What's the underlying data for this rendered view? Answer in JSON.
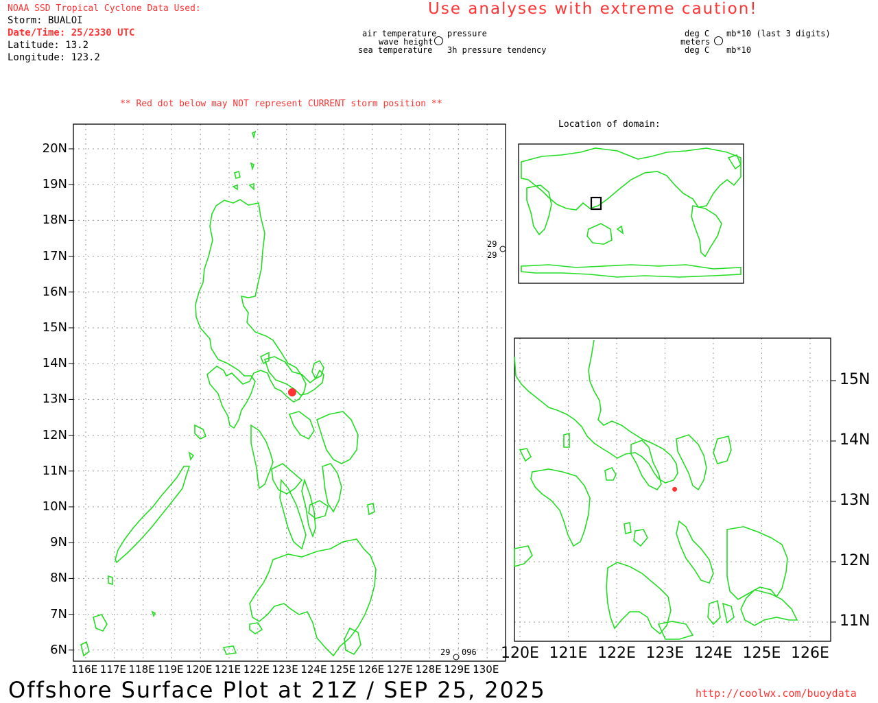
{
  "header": {
    "source_label": "NOAA SSD Tropical Cyclone Data Used:",
    "storm_line": "Storm: BUALOI",
    "datetime_line": "Date/Time: 25/2330 UTC",
    "latitude_line": "Latitude: 13.2",
    "longitude_line": "Longitude: 123.2",
    "caution": "Use analyses with extreme caution!",
    "red_dot_note": "** Red dot below may NOT represent CURRENT storm position **"
  },
  "legend": {
    "air_temperature": "air temperature",
    "wave_height": "wave height",
    "sea_temperature": "sea temperature",
    "pressure": "pressure",
    "pressure_tendency": "3h pressure tendency",
    "unit_deg_c_1": "deg C",
    "unit_meters": "meters",
    "unit_deg_c_2": "deg C",
    "unit_pressure": "mb*10 (last 3 digits)",
    "unit_tendency": "mb*10"
  },
  "main_map": {
    "lat_labels": [
      "20N",
      "19N",
      "18N",
      "17N",
      "16N",
      "15N",
      "14N",
      "13N",
      "12N",
      "11N",
      "10N",
      "9N",
      "8N",
      "7N",
      "6N"
    ],
    "lon_labels": [
      "116E",
      "117E",
      "118E",
      "119E",
      "120E",
      "121E",
      "122E",
      "123E",
      "124E",
      "125E",
      "126E",
      "127E",
      "128E",
      "129E",
      "130E"
    ],
    "storm": {
      "lat": 13.2,
      "lon": 123.2
    },
    "observations": [
      {
        "air_temp": "29",
        "sea_temp": "29"
      },
      {
        "air_temp": "29",
        "pressure": "096"
      }
    ]
  },
  "location_map": {
    "title": "Location of domain:"
  },
  "zoom_map": {
    "lat_labels": [
      "15N",
      "14N",
      "13N",
      "12N",
      "11N"
    ],
    "lon_labels": [
      "120E",
      "121E",
      "122E",
      "123E",
      "124E",
      "125E",
      "126E"
    ]
  },
  "footer": {
    "plot_title": "Offshore Surface Plot at 21Z / SEP 25, 2025",
    "url": "http://coolwx.com/buoydata"
  },
  "colors": {
    "coastline": "#22dd22",
    "storm_dot": "#ff3333",
    "caution_text": "#ff3333"
  }
}
